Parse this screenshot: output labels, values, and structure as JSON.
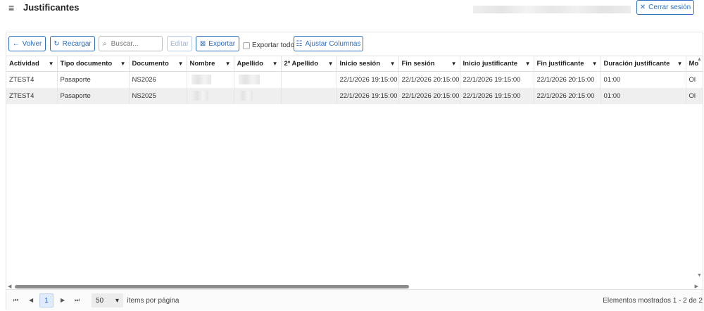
{
  "header": {
    "title": "Justificantes",
    "logout_label": "Cerrar sesión"
  },
  "toolbar": {
    "back_label": "Volver",
    "reload_label": "Recargar",
    "search_placeholder": "Buscar...",
    "edit_label": "Editar",
    "export_label": "Exportar",
    "export_all_label": "Exportar todo",
    "adjust_columns_label": "Ajustar Columnas"
  },
  "grid": {
    "columns": [
      "Actividad",
      "Tipo documento",
      "Documento",
      "Nombre",
      "Apellido",
      "2º Apellido",
      "Inicio sesión",
      "Fin sesión",
      "Inicio justificante",
      "Fin justificante",
      "Duración justificante",
      "Mo"
    ],
    "rows": [
      [
        "ZTEST4",
        "Pasaporte",
        "NS2026",
        "",
        "",
        "",
        "22/1/2026 19:15:00",
        "22/1/2026 20:15:00",
        "22/1/2026 19:15:00",
        "22/1/2026 20:15:00",
        "01:00",
        "Ol"
      ],
      [
        "ZTEST4",
        "Pasaporte",
        "NS2025",
        "",
        "",
        "",
        "22/1/2026 19:15:00",
        "22/1/2026 20:15:00",
        "22/1/2026 19:15:00",
        "22/1/2026 20:15:00",
        "01:00",
        "Ol"
      ]
    ]
  },
  "pager": {
    "current_page": "1",
    "page_size": "50",
    "per_page_label": "ítems por página",
    "info": "Elementos mostrados 1 - 2 de 2"
  },
  "colors": {
    "accent": "#2c6ebf",
    "row_alt": "#efefef"
  }
}
